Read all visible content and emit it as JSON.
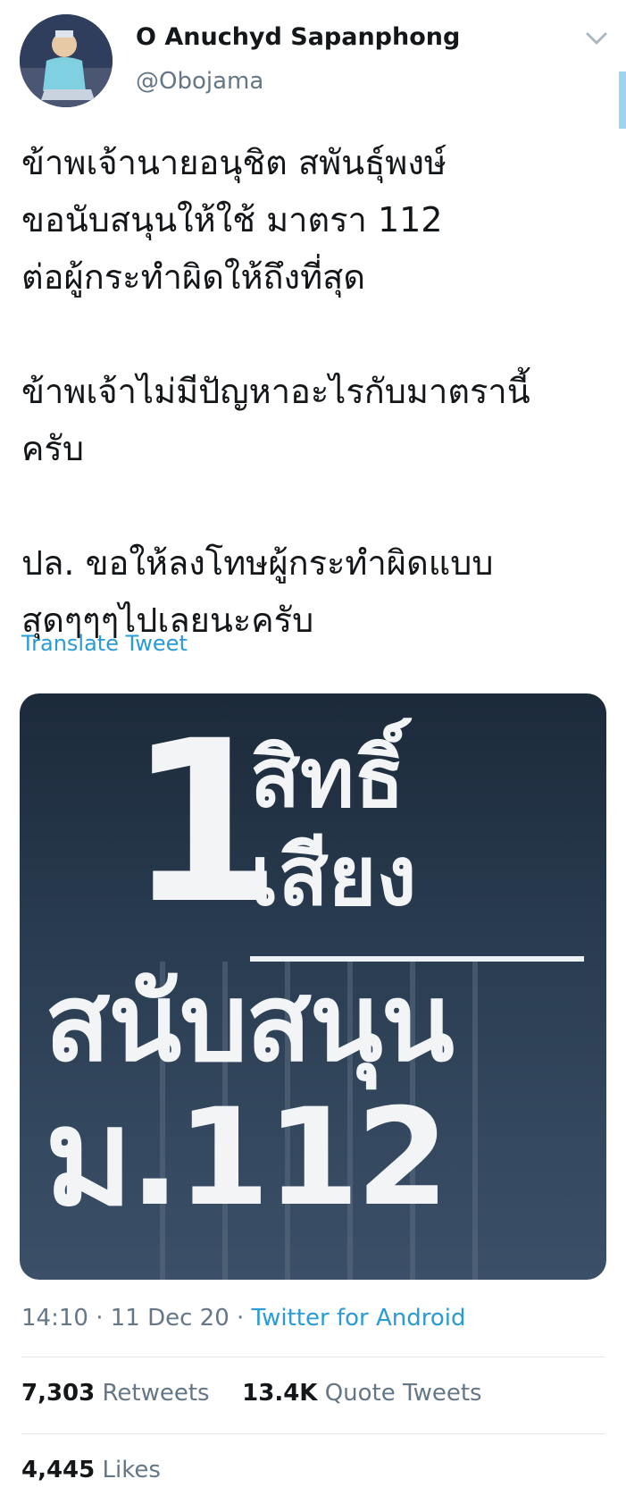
{
  "user": {
    "display_name": "O Anuchyd Sapanphong",
    "handle": "@Obojama"
  },
  "tweet": {
    "paragraphs": [
      [
        "ข้าพเจ้านายอนุชิต สพันธุ์พงษ์",
        "ขอนับสนุนให้ใช้ มาตรา 112",
        "ต่อผู้กระทำผิดให้ถึงที่สุด"
      ],
      [
        "ข้าพเจ้าไม่มีปัญหาอะไรกับมาตรานี้",
        "ครับ"
      ],
      [
        "ปล. ขอให้ลงโทษผู้กระทำผิดแบบ",
        "สุดๆๆๆไปเลยนะครับ"
      ]
    ],
    "translate_label": "Translate Tweet"
  },
  "media": {
    "digit": "1",
    "line1": "สิทธิ์",
    "line2": "เสียง",
    "line3": "สนับสนุน",
    "line4": "ม.112"
  },
  "meta": {
    "time": "14:10",
    "date": "11 Dec 20",
    "separator": "·",
    "source": "Twitter for Android"
  },
  "stats": {
    "retweets_count": "7,303",
    "retweets_label": "Retweets",
    "quotes_count": "13.4K",
    "quotes_label": "Quote Tweets",
    "likes_count": "4,445",
    "likes_label": "Likes"
  },
  "icons": {
    "chevron": "chevron-down-icon",
    "avatar": "avatar"
  }
}
